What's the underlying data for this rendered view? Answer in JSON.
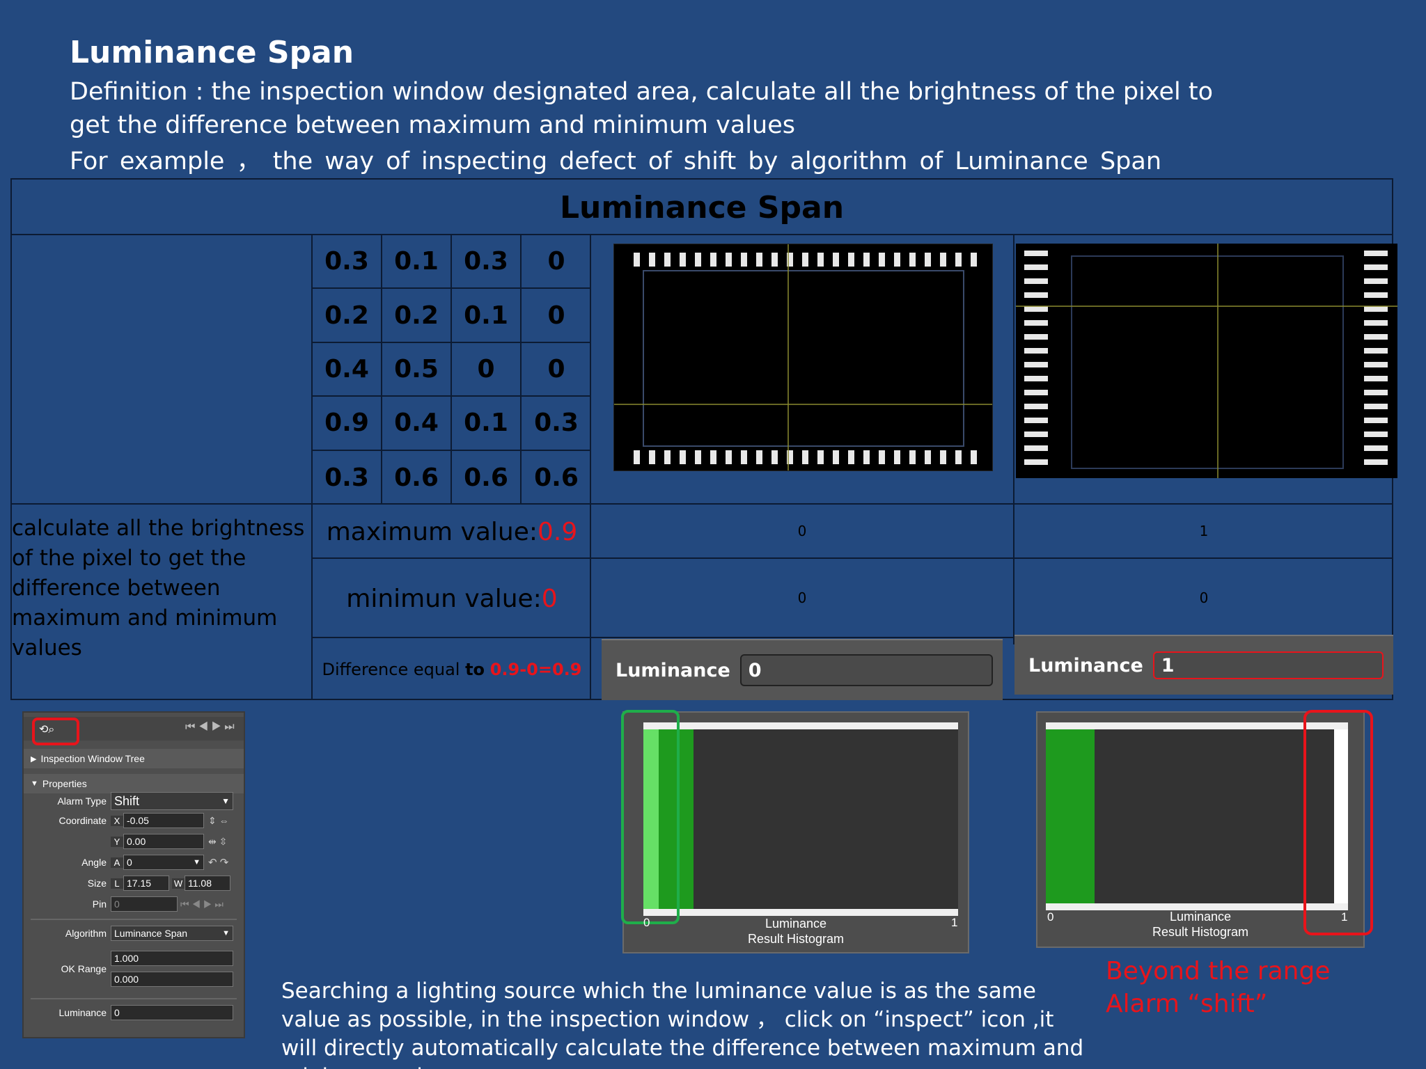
{
  "header": {
    "title": "Luminance Span",
    "definition": "Definition :  the inspection window designated area, calculate all the brightness of the pixel to get the difference between maximum and minimum values",
    "example": "For example  ，  the way of  inspecting  defect of shift  by  algorithm  of  Luminance  Span"
  },
  "table": {
    "title": "Luminance Span",
    "grid": [
      "0.3",
      "0.1",
      "0.3",
      "0",
      "0.2",
      "0.2",
      "0.1",
      "0",
      "0.4",
      "0.5",
      "0",
      "0",
      "0.9",
      "0.4",
      "0.1",
      "0.3",
      "0.3",
      "0.6",
      "0.6",
      "0.6"
    ],
    "description": "calculate all the brightness of the pixel to get the difference between maximum and minimum values",
    "max_label": "maximum value:",
    "max_value": "0.9",
    "min_label": "minimun value:",
    "min_value": "0",
    "diff_label": "Difference equal ",
    "diff_to": "to",
    "diff_value": "0.9-0=0.9",
    "col1_max": "0",
    "col2_max": "1",
    "col1_min": "0",
    "col2_min": "0",
    "lum_label": "Luminance",
    "lum1_value": "0",
    "lum2_value": "1"
  },
  "panel": {
    "inspection_tree": "Inspection Window Tree",
    "properties": "Properties",
    "alarm_type_label": "Alarm Type",
    "alarm_type_value": "Shift",
    "coordinate_label": "Coordinate",
    "x_tag": "X",
    "x_value": "-0.05",
    "y_tag": "Y",
    "y_value": "0.00",
    "angle_label": "Angle",
    "a_tag": "A",
    "a_value": "0",
    "size_label": "Size",
    "l_tag": "L",
    "l_value": "17.15",
    "w_tag": "W",
    "w_value": "11.08",
    "pin_label": "Pin",
    "pin_value": "0",
    "algorithm_label": "Algorithm",
    "algorithm_value": "Luminance Span",
    "ok_range_label": "OK Range",
    "ok_max": "1.000",
    "ok_min": "0.000",
    "luminance_label": "Luminance",
    "luminance_value": "0"
  },
  "histograms": [
    {
      "caption_1": "Luminance",
      "caption_2": "Result Histogram",
      "min": "0",
      "max": "1"
    },
    {
      "caption_1": "Luminance",
      "caption_2": "Result Histogram",
      "min": "0",
      "max": "1"
    }
  ],
  "footer": {
    "instructions": "Searching  a lighting source which  the luminance value is as the same value as possible, in the inspection window  ，  click  on “inspect”  icon ,it will directly automatically  calculate  the difference between maximum and minimum values",
    "alarm_line1": "Beyond the range",
    "alarm_line2": "Alarm “shift”"
  },
  "colors": {
    "background": "#23497f",
    "alarm_red": "#e8141b",
    "histogram_green": "#1e9a1e",
    "highlight_green": "#1fae4a"
  }
}
